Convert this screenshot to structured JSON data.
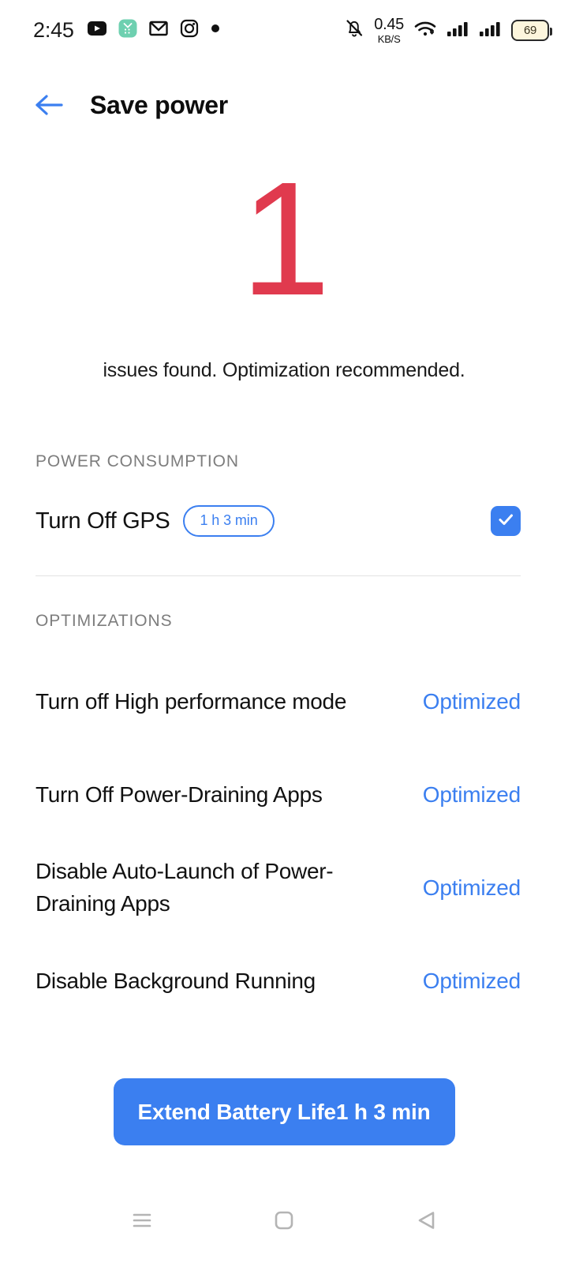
{
  "status_bar": {
    "clock": "2:45",
    "app_icons": [
      {
        "name": "youtube-icon",
        "label": "YouTube"
      },
      {
        "name": "mint-app-icon",
        "label": "App"
      },
      {
        "name": "gmail-icon",
        "label": "Gmail"
      },
      {
        "name": "instagram-icon",
        "label": "Instagram"
      },
      {
        "name": "more-dot-icon",
        "label": "More"
      }
    ],
    "silent_icon": "bell-off-icon",
    "net_speed_value": "0.45",
    "net_speed_unit": "KB/S",
    "wifi_icon": "wifi-icon",
    "signal_icons": [
      "signal-bars-icon",
      "signal-bars-icon"
    ],
    "battery_level": "69"
  },
  "header": {
    "back_icon": "back-arrow-icon",
    "title": "Save power"
  },
  "hero": {
    "count": "1",
    "count_color": "#E03A4E",
    "subtitle": "issues found. Optimization recommended."
  },
  "power_consumption": {
    "section_label": "POWER CONSUMPTION",
    "item": {
      "name": "Turn Off GPS",
      "time_badge": "1 h 3 min",
      "checked": true,
      "check_icon": "checkmark-icon"
    }
  },
  "optimizations": {
    "section_label": "OPTIMIZATIONS",
    "items": [
      {
        "name": "Turn off High performance mode",
        "status": "Optimized"
      },
      {
        "name": "Turn Off Power-Draining Apps",
        "status": "Optimized"
      },
      {
        "name": "Disable Auto-Launch of Power-Draining Apps",
        "status": "Optimized"
      },
      {
        "name": "Disable Background Running",
        "status": "Optimized"
      }
    ]
  },
  "cta": {
    "label": "Extend Battery Life1 h 3 min",
    "color": "#3B7FF0"
  },
  "nav_bar": {
    "recents_icon": "menu-lines-icon",
    "home_icon": "home-square-icon",
    "back_icon": "back-triangle-icon"
  }
}
